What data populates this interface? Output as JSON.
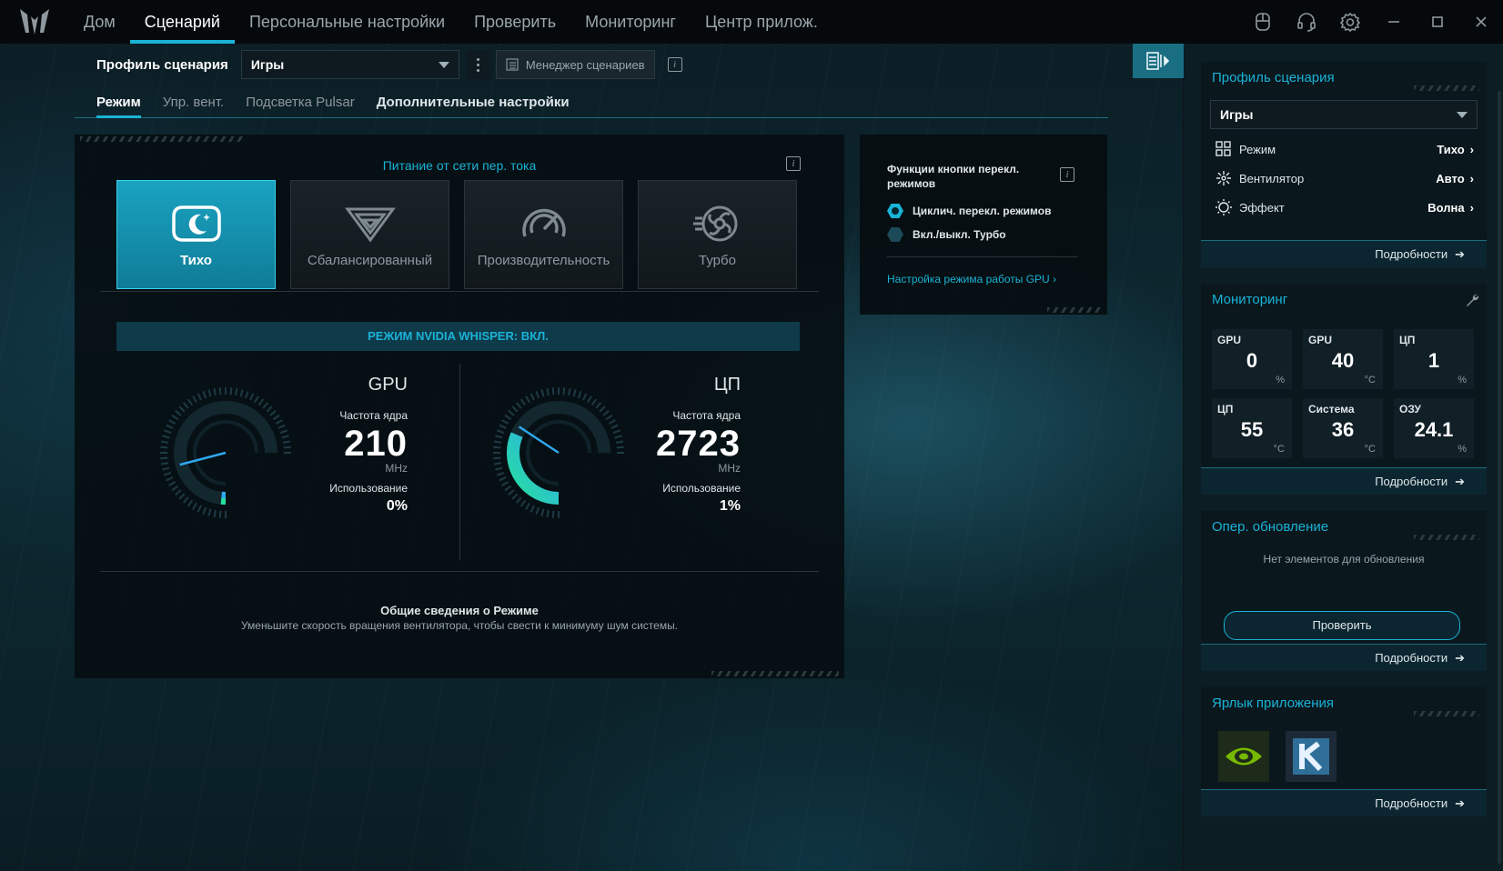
{
  "nav": {
    "items": [
      "Дом",
      "Сценарий",
      "Персональные настройки",
      "Проверить",
      "Мониторинг",
      "Центр прилож."
    ],
    "active_index": 1
  },
  "window_controls": {
    "icons": [
      "device-icon",
      "headset-icon",
      "settings-icon",
      "minimize-icon",
      "maximize-icon",
      "close-icon"
    ]
  },
  "profile": {
    "label": "Профиль сценария",
    "value": "Игры",
    "manager_button": "Менеджер сценариев"
  },
  "subtabs": [
    "Режим",
    "Упр. вент.",
    "Подсветка Pulsar",
    "Дополнительные настройки"
  ],
  "mode_panel": {
    "power_title": "Питание от сети пер. тока",
    "modes": [
      {
        "label": "Тихо",
        "active": true
      },
      {
        "label": "Сбалансированный",
        "active": false
      },
      {
        "label": "Производительность",
        "active": false
      },
      {
        "label": "Турбо",
        "active": false
      }
    ],
    "whisper": "РЕЖИМ NVIDIA WHISPER: ВКЛ.",
    "gpu": {
      "title": "GPU",
      "freq_label": "Частота ядра",
      "freq_value": "210",
      "freq_unit": "MHz",
      "usage_label": "Использование",
      "usage_value": "0%",
      "level": 0.02
    },
    "cpu": {
      "title": "ЦП",
      "freq_label": "Частота ядра",
      "freq_value": "2723",
      "freq_unit": "MHz",
      "usage_label": "Использование",
      "usage_value": "1%",
      "level": 0.42
    },
    "summary_title": "Общие сведения о Режиме",
    "summary_text": "Уменьшите скорость вращения вентилятора, чтобы свести к минимуму шум системы."
  },
  "button_functions": {
    "title": "Функции кнопки перекл. режимов",
    "options": [
      {
        "label": "Циклич. перекл. режимов",
        "selected": true
      },
      {
        "label": "Вкл./выкл. Турбо",
        "selected": false
      }
    ],
    "gpu_link": "Настройка режима работы GPU ›"
  },
  "sidebar": {
    "profile_card": {
      "title": "Профиль сценария",
      "select_value": "Игры",
      "rows": [
        {
          "label": "Режим",
          "value": "Тихо"
        },
        {
          "label": "Вентилятор",
          "value": "Авто"
        },
        {
          "label": "Эффект",
          "value": "Волна"
        }
      ],
      "more": "Подробности"
    },
    "monitoring_card": {
      "title": "Мониторинг",
      "tiles": [
        {
          "title": "GPU",
          "value": "0",
          "unit": "%"
        },
        {
          "title": "GPU",
          "value": "40",
          "unit": "°C"
        },
        {
          "title": "ЦП",
          "value": "1",
          "unit": "%"
        },
        {
          "title": "ЦП",
          "value": "55",
          "unit": "°C"
        },
        {
          "title": "Система",
          "value": "36",
          "unit": "°C"
        },
        {
          "title": "ОЗУ",
          "value": "24.1",
          "unit": "%"
        }
      ],
      "more": "Подробности"
    },
    "update_card": {
      "title": "Опер. обновление",
      "empty": "Нет элементов для обновления",
      "check_button": "Проверить",
      "more": "Подробности"
    },
    "shortcut_card": {
      "title": "Ярлык приложения",
      "apps": [
        "nvidia-icon",
        "k-app-icon"
      ],
      "more": "Подробности"
    }
  },
  "colors": {
    "accent": "#19b3d6",
    "active_mode": "#1aa3c0",
    "gauge_green": "#27e0a0",
    "gauge_blue": "#2fa8f0"
  }
}
